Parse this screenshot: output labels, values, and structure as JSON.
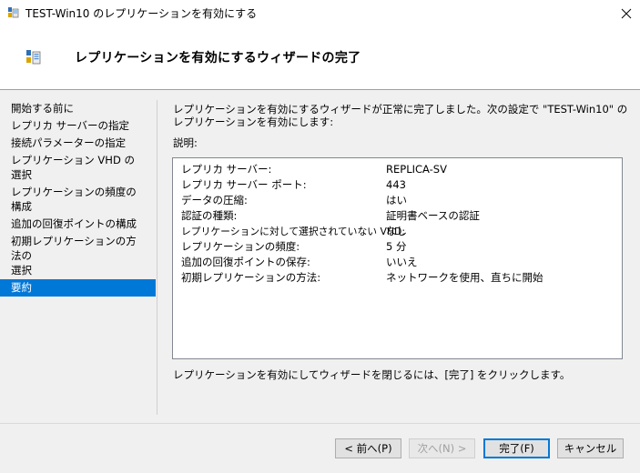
{
  "window": {
    "title": "TEST-Win10 のレプリケーションを有効にする"
  },
  "header": {
    "heading": "レプリケーションを有効にするウィザードの完了"
  },
  "nav": {
    "items": [
      {
        "label": "開始する前に"
      },
      {
        "label": "レプリカ サーバーの指定"
      },
      {
        "label": "接続パラメーターの指定"
      },
      {
        "label": "レプリケーション VHD の選択"
      },
      {
        "label": "レプリケーションの頻度の構成"
      },
      {
        "label": "追加の回復ポイントの構成"
      },
      {
        "label": "初期レプリケーションの方法の\n選択"
      },
      {
        "label": "要約"
      }
    ],
    "active_index": 7
  },
  "main": {
    "intro": "レプリケーションを有効にするウィザードが正常に完了しました。次の設定で \"TEST-Win10\" のレプリケーションを有効にします:",
    "description_label": "説明:",
    "summary": [
      {
        "key": "レプリカ サーバー:",
        "value": "REPLICA-SV"
      },
      {
        "key": "レプリカ サーバー ポート:",
        "value": "443"
      },
      {
        "key": "データの圧縮:",
        "value": "はい"
      },
      {
        "key": "認証の種類:",
        "value": "証明書ベースの認証"
      },
      {
        "key": "レプリケーションに対して選択されていない VHD:",
        "value": "なし"
      },
      {
        "key": "レプリケーションの頻度:",
        "value": "5 分"
      },
      {
        "key": "追加の回復ポイントの保存:",
        "value": "いいえ"
      },
      {
        "key": "初期レプリケーションの方法:",
        "value": "ネットワークを使用、直ちに開始"
      }
    ],
    "footer_note": "レプリケーションを有効にしてウィザードを閉じるには、[完了] をクリックします。"
  },
  "buttons": {
    "back": "< 前へ(P)",
    "next": "次へ(N) >",
    "finish": "完了(F)",
    "cancel": "キャンセル"
  },
  "colors": {
    "accent": "#0078d7"
  }
}
